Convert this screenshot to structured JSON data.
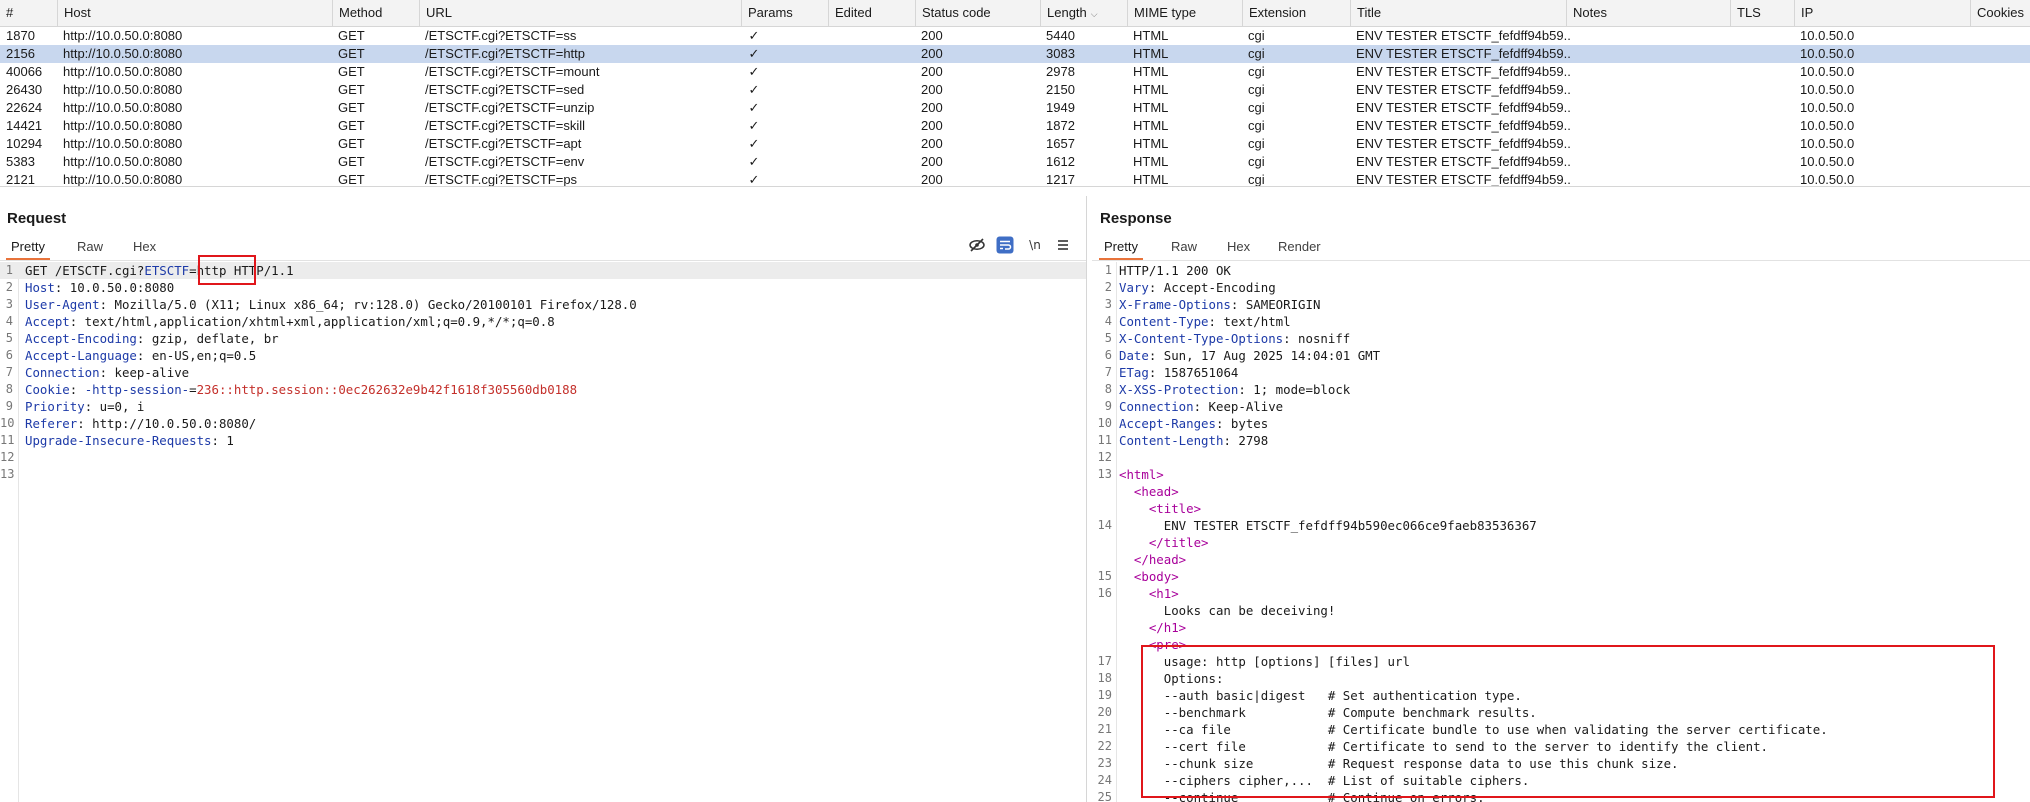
{
  "history": {
    "columns": [
      "#",
      "Host",
      "Method",
      "URL",
      "Params",
      "Edited",
      "Status code",
      "Length",
      "MIME type",
      "Extension",
      "Title",
      "Notes",
      "TLS",
      "IP",
      "Cookies"
    ],
    "rows": [
      {
        "num": "1870",
        "host": "http://10.0.50.0:8080",
        "method": "GET",
        "url": "/ETSCTF.cgi?ETSCTF=ss",
        "params": "✓",
        "status": "200",
        "length": "5440",
        "mime": "HTML",
        "ext": "cgi",
        "title": "ENV TESTER ETSCTF_fefdff94b59...",
        "ip": "10.0.50.0"
      },
      {
        "num": "2156",
        "host": "http://10.0.50.0:8080",
        "method": "GET",
        "url": "/ETSCTF.cgi?ETSCTF=http",
        "params": "✓",
        "status": "200",
        "length": "3083",
        "mime": "HTML",
        "ext": "cgi",
        "title": "ENV TESTER ETSCTF_fefdff94b59...",
        "ip": "10.0.50.0",
        "selected": true
      },
      {
        "num": "40066",
        "host": "http://10.0.50.0:8080",
        "method": "GET",
        "url": "/ETSCTF.cgi?ETSCTF=mount",
        "params": "✓",
        "status": "200",
        "length": "2978",
        "mime": "HTML",
        "ext": "cgi",
        "title": "ENV TESTER ETSCTF_fefdff94b59...",
        "ip": "10.0.50.0"
      },
      {
        "num": "26430",
        "host": "http://10.0.50.0:8080",
        "method": "GET",
        "url": "/ETSCTF.cgi?ETSCTF=sed",
        "params": "✓",
        "status": "200",
        "length": "2150",
        "mime": "HTML",
        "ext": "cgi",
        "title": "ENV TESTER ETSCTF_fefdff94b59...",
        "ip": "10.0.50.0"
      },
      {
        "num": "22624",
        "host": "http://10.0.50.0:8080",
        "method": "GET",
        "url": "/ETSCTF.cgi?ETSCTF=unzip",
        "params": "✓",
        "status": "200",
        "length": "1949",
        "mime": "HTML",
        "ext": "cgi",
        "title": "ENV TESTER ETSCTF_fefdff94b59...",
        "ip": "10.0.50.0"
      },
      {
        "num": "14421",
        "host": "http://10.0.50.0:8080",
        "method": "GET",
        "url": "/ETSCTF.cgi?ETSCTF=skill",
        "params": "✓",
        "status": "200",
        "length": "1872",
        "mime": "HTML",
        "ext": "cgi",
        "title": "ENV TESTER ETSCTF_fefdff94b59...",
        "ip": "10.0.50.0"
      },
      {
        "num": "10294",
        "host": "http://10.0.50.0:8080",
        "method": "GET",
        "url": "/ETSCTF.cgi?ETSCTF=apt",
        "params": "✓",
        "status": "200",
        "length": "1657",
        "mime": "HTML",
        "ext": "cgi",
        "title": "ENV TESTER ETSCTF_fefdff94b59...",
        "ip": "10.0.50.0"
      },
      {
        "num": "5383",
        "host": "http://10.0.50.0:8080",
        "method": "GET",
        "url": "/ETSCTF.cgi?ETSCTF=env",
        "params": "✓",
        "status": "200",
        "length": "1612",
        "mime": "HTML",
        "ext": "cgi",
        "title": "ENV TESTER ETSCTF_fefdff94b59...",
        "ip": "10.0.50.0"
      },
      {
        "num": "2121",
        "host": "http://10.0.50.0:8080",
        "method": "GET",
        "url": "/ETSCTF.cgi?ETSCTF=ps",
        "params": "✓",
        "status": "200",
        "length": "1217",
        "mime": "HTML",
        "ext": "cgi",
        "title": "ENV TESTER ETSCTF_fefdff94b59...",
        "ip": "10.0.50.0"
      }
    ]
  },
  "request": {
    "title": "Request",
    "tabs": [
      "Pretty",
      "Raw",
      "Hex"
    ],
    "icons": [
      "hide-icon",
      "wrap-lines-icon",
      "newline-icon",
      "menu-icon"
    ],
    "newline_glyph": "\\n",
    "lines": [
      {
        "n": "1",
        "parts": [
          {
            "t": "GET /ETSCTF.cgi?",
            "c": "hv"
          },
          {
            "t": "ETSCTF",
            "c": "hk"
          },
          {
            "t": "=http HTTP/1.1",
            "c": "hv"
          }
        ]
      },
      {
        "n": "2",
        "parts": [
          {
            "t": "Host",
            "c": "hk"
          },
          {
            "t": ": 10.0.50.0:8080",
            "c": "hv"
          }
        ]
      },
      {
        "n": "3",
        "parts": [
          {
            "t": "User-Agent",
            "c": "hk"
          },
          {
            "t": ": Mozilla/5.0 (X11; Linux x86_64; rv:128.0) Gecko/20100101 Firefox/128.0",
            "c": "hv"
          }
        ]
      },
      {
        "n": "4",
        "parts": [
          {
            "t": "Accept",
            "c": "hk"
          },
          {
            "t": ": text/html,application/xhtml+xml,application/xml;q=0.9,*/*;q=0.8",
            "c": "hv"
          }
        ]
      },
      {
        "n": "5",
        "parts": [
          {
            "t": "Accept-Encoding",
            "c": "hk"
          },
          {
            "t": ": gzip, deflate, br",
            "c": "hv"
          }
        ]
      },
      {
        "n": "6",
        "parts": [
          {
            "t": "Accept-Language",
            "c": "hk"
          },
          {
            "t": ": en-US,en;q=0.5",
            "c": "hv"
          }
        ]
      },
      {
        "n": "7",
        "parts": [
          {
            "t": "Connection",
            "c": "hk"
          },
          {
            "t": ": keep-alive",
            "c": "hv"
          }
        ]
      },
      {
        "n": "8",
        "parts": [
          {
            "t": "Cookie",
            "c": "hk"
          },
          {
            "t": ": ",
            "c": "hv"
          },
          {
            "t": "-http-session-",
            "c": "hk"
          },
          {
            "t": "=",
            "c": "hv"
          },
          {
            "t": "236::http.session::0ec262632e9b42f1618f305560db0188",
            "c": "pv"
          }
        ]
      },
      {
        "n": "9",
        "parts": [
          {
            "t": "Priority",
            "c": "hk"
          },
          {
            "t": ": u=0, i",
            "c": "hv"
          }
        ]
      },
      {
        "n": "10",
        "parts": [
          {
            "t": "Referer",
            "c": "hk"
          },
          {
            "t": ": http://10.0.50.0:8080/",
            "c": "hv"
          }
        ]
      },
      {
        "n": "11",
        "parts": [
          {
            "t": "Upgrade-Insecure-Requests",
            "c": "hk"
          },
          {
            "t": ": 1",
            "c": "hv"
          }
        ]
      },
      {
        "n": "12",
        "parts": []
      },
      {
        "n": "13",
        "parts": []
      }
    ]
  },
  "response": {
    "title": "Response",
    "tabs": [
      "Pretty",
      "Raw",
      "Hex",
      "Render"
    ],
    "lines": [
      {
        "n": "1",
        "parts": [
          {
            "t": "HTTP/1.1 200 OK",
            "c": "hv"
          }
        ]
      },
      {
        "n": "2",
        "parts": [
          {
            "t": "Vary",
            "c": "hk"
          },
          {
            "t": ": Accept-Encoding",
            "c": "hv"
          }
        ]
      },
      {
        "n": "3",
        "parts": [
          {
            "t": "X-Frame-Options",
            "c": "hk"
          },
          {
            "t": ": SAMEORIGIN",
            "c": "hv"
          }
        ]
      },
      {
        "n": "4",
        "parts": [
          {
            "t": "Content-Type",
            "c": "hk"
          },
          {
            "t": ": text/html",
            "c": "hv"
          }
        ]
      },
      {
        "n": "5",
        "parts": [
          {
            "t": "X-Content-Type-Options",
            "c": "hk"
          },
          {
            "t": ": nosniff",
            "c": "hv"
          }
        ]
      },
      {
        "n": "6",
        "parts": [
          {
            "t": "Date",
            "c": "hk"
          },
          {
            "t": ": Sun, 17 Aug 2025 14:04:01 GMT",
            "c": "hv"
          }
        ]
      },
      {
        "n": "7",
        "parts": [
          {
            "t": "ETag",
            "c": "hk"
          },
          {
            "t": ": 1587651064",
            "c": "hv"
          }
        ]
      },
      {
        "n": "8",
        "parts": [
          {
            "t": "X-XSS-Protection",
            "c": "hk"
          },
          {
            "t": ": 1; mode=block",
            "c": "hv"
          }
        ]
      },
      {
        "n": "9",
        "parts": [
          {
            "t": "Connection",
            "c": "hk"
          },
          {
            "t": ": Keep-Alive",
            "c": "hv"
          }
        ]
      },
      {
        "n": "10",
        "parts": [
          {
            "t": "Accept-Ranges",
            "c": "hk"
          },
          {
            "t": ": bytes",
            "c": "hv"
          }
        ]
      },
      {
        "n": "11",
        "parts": [
          {
            "t": "Content-Length",
            "c": "hk"
          },
          {
            "t": ": 2798",
            "c": "hv"
          }
        ]
      },
      {
        "n": "12",
        "parts": []
      },
      {
        "n": "13",
        "parts": [
          {
            "t": "<html>",
            "c": "tg"
          }
        ]
      },
      {
        "n": "",
        "parts": [
          {
            "t": "  <head>",
            "c": "tg"
          }
        ]
      },
      {
        "n": "",
        "parts": [
          {
            "t": "    <title>",
            "c": "tg"
          }
        ]
      },
      {
        "n": "14",
        "parts": [
          {
            "t": "      ENV TESTER ETSCTF_fefdff94b590ec066ce9faeb83536367",
            "c": "hv"
          }
        ]
      },
      {
        "n": "",
        "parts": [
          {
            "t": "    </title>",
            "c": "tg"
          }
        ]
      },
      {
        "n": "",
        "parts": [
          {
            "t": "  </head>",
            "c": "tg"
          }
        ]
      },
      {
        "n": "15",
        "parts": [
          {
            "t": "  <body>",
            "c": "tg"
          }
        ]
      },
      {
        "n": "16",
        "parts": [
          {
            "t": "    <h1>",
            "c": "tg"
          }
        ]
      },
      {
        "n": "",
        "parts": [
          {
            "t": "      Looks can be deceiving!",
            "c": "hv"
          }
        ]
      },
      {
        "n": "",
        "parts": [
          {
            "t": "    </h1>",
            "c": "tg"
          }
        ]
      },
      {
        "n": "",
        "parts": [
          {
            "t": "    <pre>",
            "c": "tg"
          }
        ]
      },
      {
        "n": "17",
        "parts": [
          {
            "t": "      usage: http [options] [files] url",
            "c": "hv"
          }
        ]
      },
      {
        "n": "18",
        "parts": [
          {
            "t": "      Options:",
            "c": "hv"
          }
        ]
      },
      {
        "n": "19",
        "parts": [
          {
            "t": "      --auth basic|digest   # Set authentication type.",
            "c": "hv"
          }
        ]
      },
      {
        "n": "20",
        "parts": [
          {
            "t": "      --benchmark           # Compute benchmark results.",
            "c": "hv"
          }
        ]
      },
      {
        "n": "21",
        "parts": [
          {
            "t": "      --ca file             # Certificate bundle to use when validating the server certificate.",
            "c": "hv"
          }
        ]
      },
      {
        "n": "22",
        "parts": [
          {
            "t": "      --cert file           # Certificate to send to the server to identify the client.",
            "c": "hv"
          }
        ]
      },
      {
        "n": "23",
        "parts": [
          {
            "t": "      --chunk size          # Request response data to use this chunk size.",
            "c": "hv"
          }
        ]
      },
      {
        "n": "24",
        "parts": [
          {
            "t": "      --ciphers cipher,...  # List of suitable ciphers.",
            "c": "hv"
          }
        ]
      },
      {
        "n": "25",
        "parts": [
          {
            "t": "      --continue            # Continue on errors.",
            "c": "hv"
          }
        ]
      }
    ]
  },
  "colors": {
    "accent": "#e8733b",
    "selected_row": "#c8d7ee",
    "highlight_box": "#e0161b",
    "header_key": "#1d3aa8",
    "tag": "#a8009a",
    "cookie_value": "#c4302b"
  }
}
